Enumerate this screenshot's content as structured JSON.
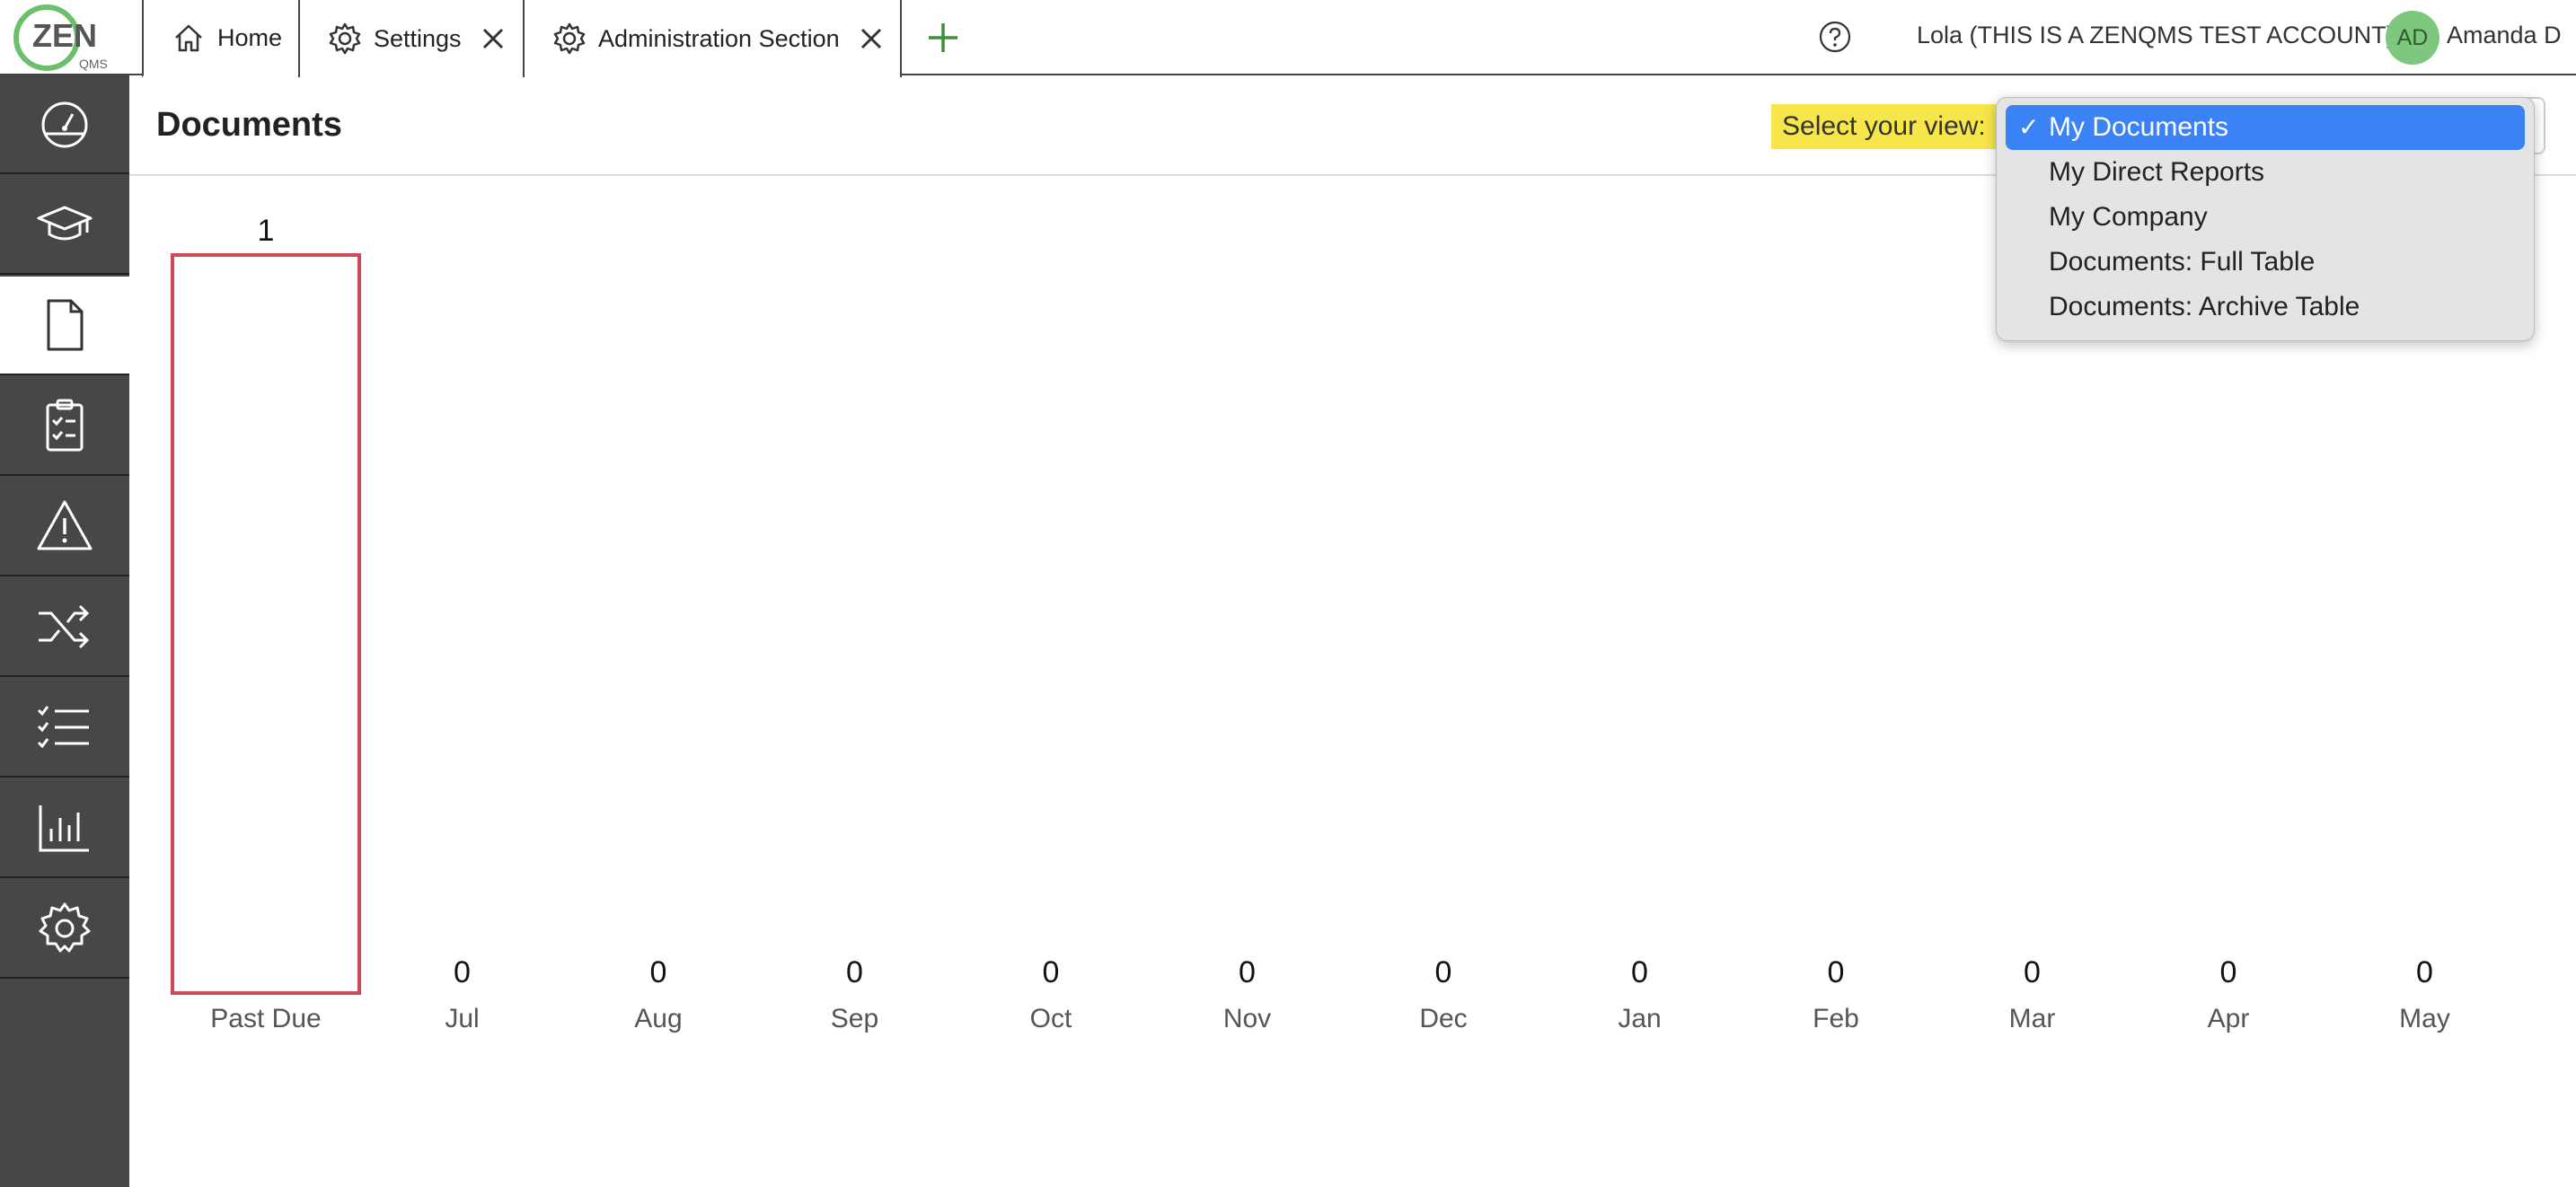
{
  "tabs": [
    {
      "label": "Home",
      "icon": "home-icon",
      "closable": false
    },
    {
      "label": "Settings",
      "icon": "gear-icon",
      "closable": true
    },
    {
      "label": "Administration Section",
      "icon": "gear-icon",
      "closable": true
    }
  ],
  "logo": {
    "text": "ZEN",
    "subtext": "QMS"
  },
  "account": {
    "company": "Lola (THIS IS A ZENQMS TEST ACCOUNT)",
    "initials": "AD",
    "user": "Amanda D"
  },
  "sidebar": {
    "items": [
      {
        "icon": "dashboard-gauge-icon"
      },
      {
        "icon": "training-cap-icon"
      },
      {
        "icon": "document-icon",
        "active": true
      },
      {
        "icon": "clipboard-checklist-icon"
      },
      {
        "icon": "warning-triangle-icon"
      },
      {
        "icon": "shuffle-change-icon"
      },
      {
        "icon": "task-list-icon"
      },
      {
        "icon": "reports-chart-icon"
      },
      {
        "icon": "settings-gear-icon"
      }
    ]
  },
  "page": {
    "title": "Documents",
    "view_label": "Select your view:"
  },
  "view_menu": {
    "selected": "My Documents",
    "options": [
      "My Documents",
      "My Direct Reports",
      "My Company",
      "Documents: Full Table",
      "Documents: Archive Table"
    ]
  },
  "colors": {
    "bar_outline": "#cc4b57",
    "sidebar": "#474747",
    "highlight": "#f7e64a",
    "menu_selected": "#3b82f6"
  },
  "chart_data": {
    "type": "bar",
    "categories": [
      "Past Due",
      "Jul",
      "Aug",
      "Sep",
      "Oct",
      "Nov",
      "Dec",
      "Jan",
      "Feb",
      "Mar",
      "Apr",
      "May"
    ],
    "values": [
      1,
      0,
      0,
      0,
      0,
      0,
      0,
      0,
      0,
      0,
      0,
      0
    ],
    "title": "",
    "xlabel": "",
    "ylabel": "",
    "ylim": [
      0,
      1
    ],
    "grid": false
  }
}
